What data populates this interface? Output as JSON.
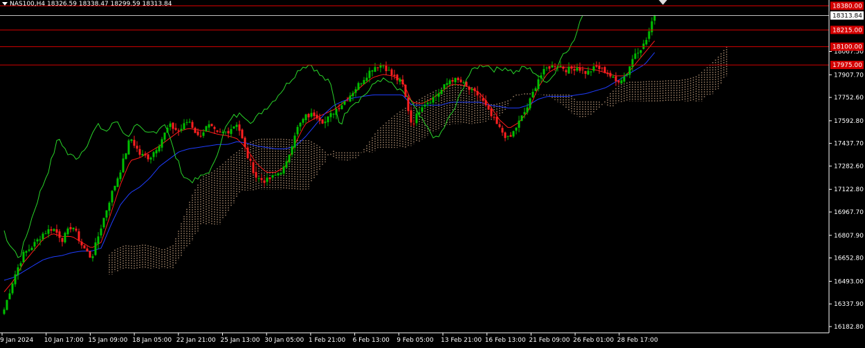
{
  "header": {
    "symbol": "NAS100,H4",
    "open": "18326.59",
    "high": "18338.47",
    "low": "18299.59",
    "close": "18313.84"
  },
  "colors": {
    "background": "#000000",
    "bull_candle": "#00c000",
    "bear_candle": "#ff2020",
    "tenkan": "#ff1a1a",
    "kijun": "#1f3dff",
    "chikou": "#29d529",
    "kumo": "#f5c8a0",
    "level_line": "#d40000",
    "current_price_line": "#c0c0c0",
    "axis": "#ffffff"
  },
  "chart_data": {
    "type": "candlestick",
    "symbol": "NAS100",
    "timeframe": "H4",
    "ylim": [
      16140,
      18420
    ],
    "y_ticks": [
      "18067.50",
      "17907.70",
      "17752.60",
      "17592.80",
      "17437.70",
      "17282.60",
      "17122.80",
      "16967.70",
      "16807.90",
      "16652.80",
      "16493.00",
      "16337.90",
      "16182.80"
    ],
    "x_ticks": [
      "9 Jan 2024",
      "10 Jan 17:00",
      "15 Jan 09:00",
      "18 Jan 05:00",
      "22 Jan 21:00",
      "25 Jan 13:00",
      "30 Jan 05:00",
      "1 Feb 21:00",
      "6 Feb 13:00",
      "9 Feb 05:00",
      "13 Feb 21:00",
      "16 Feb 13:00",
      "21 Feb 09:00",
      "26 Feb 01:00",
      "28 Feb 17:00"
    ],
    "current_price": 18313.84,
    "levels": [
      {
        "label": "18380.00",
        "value": 18380.0
      },
      {
        "label": "18215.00",
        "value": 18215.0
      },
      {
        "label": "18100.00",
        "value": 18100.0
      },
      {
        "label": "17975.00",
        "value": 17975.0
      }
    ],
    "price_path": [
      16300,
      16520,
      16680,
      16740,
      16820,
      16860,
      16780,
      16880,
      16740,
      16650,
      16870,
      17080,
      17260,
      17480,
      17360,
      17340,
      17440,
      17560,
      17520,
      17600,
      17480,
      17560,
      17500,
      17520,
      17580,
      17360,
      17200,
      17180,
      17220,
      17280,
      17520,
      17620,
      17640,
      17580,
      17660,
      17720,
      17800,
      17880,
      17960,
      17980,
      17900,
      17850,
      17560,
      17700,
      17740,
      17800,
      17880,
      17860,
      17800,
      17760,
      17640,
      17540,
      17460,
      17580,
      17700,
      17880,
      17960,
      17980,
      17940,
      17960,
      17920,
      17960,
      17930,
      17860,
      17900,
      18060,
      18120,
      18313
    ],
    "tenkan_path": [
      16420,
      16500,
      16620,
      16700,
      16780,
      16820,
      16800,
      16800,
      16760,
      16720,
      16760,
      16960,
      17160,
      17320,
      17340,
      17380,
      17420,
      17470,
      17520,
      17540,
      17530,
      17520,
      17500,
      17490,
      17470,
      17400,
      17300,
      17240,
      17240,
      17280,
      17440,
      17570,
      17610,
      17640,
      17670,
      17720,
      17780,
      17840,
      17890,
      17910,
      17900,
      17870,
      17720,
      17710,
      17740,
      17790,
      17840,
      17840,
      17820,
      17780,
      17700,
      17600,
      17540,
      17580,
      17660,
      17820,
      17920,
      17960,
      17960,
      17960,
      17950,
      17940,
      17920,
      17900,
      17900,
      17980,
      18060,
      18140
    ],
    "kijun_path": [
      16500,
      16520,
      16560,
      16600,
      16640,
      16660,
      16670,
      16690,
      16700,
      16700,
      16720,
      16880,
      17020,
      17100,
      17140,
      17200,
      17280,
      17330,
      17380,
      17400,
      17410,
      17420,
      17430,
      17430,
      17450,
      17440,
      17420,
      17410,
      17400,
      17400,
      17420,
      17480,
      17560,
      17640,
      17700,
      17730,
      17750,
      17760,
      17770,
      17770,
      17770,
      17770,
      17700,
      17700,
      17700,
      17700,
      17720,
      17720,
      17720,
      17720,
      17700,
      17690,
      17680,
      17680,
      17700,
      17740,
      17760,
      17760,
      17760,
      17770,
      17780,
      17800,
      17820,
      17860,
      17900,
      17940,
      17980,
      18060
    ]
  }
}
